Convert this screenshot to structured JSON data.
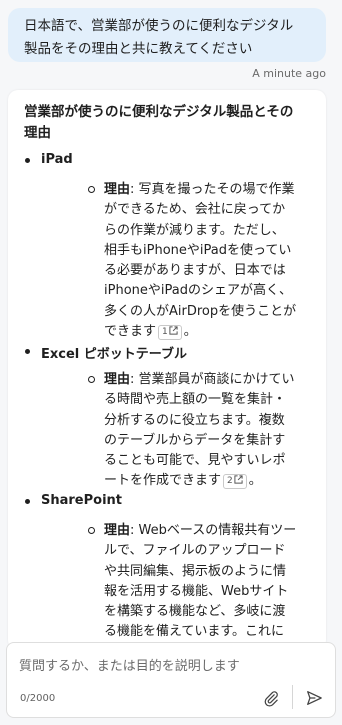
{
  "user_message": {
    "line1": "日本語で、営業部が使うのに便利なデジタル",
    "line2": "製品をその理由と共に教えてください",
    "timestamp": "A minute ago"
  },
  "answer": {
    "title_line1": "営業部が使うのに便利なデジタル製品とその",
    "title_line2": "理由",
    "reason_label": "理由",
    "items": [
      {
        "name": "iPad",
        "reason_lines": [
          ": 写真を撮ったその場で作業",
          "ができるため、会社に戻ってか",
          "らの作業が減ります。ただし、",
          "相手もiPhoneやiPadを使ってい",
          "る必要がありますが、日本では",
          "iPhoneやiPadのシェアが高く、",
          "多くの人がAirDropを使うことが",
          "できます"
        ],
        "citation": "1",
        "end": "。"
      },
      {
        "name": "Excel ピボットテーブル",
        "reason_lines": [
          ": 営業部員が商談にかけてい",
          "る時間や売上額の一覧を集計・",
          "分析するのに役立ちます。複数",
          "のテーブルからデータを集計す",
          "ることも可能で、見やすいレポ",
          "ートを作成できます"
        ],
        "citation": "2",
        "end": "。"
      },
      {
        "name": "SharePoint",
        "reason_lines": [
          ": Webベースの情報共有ツー",
          "ルで、ファイルのアップロード",
          "や共同編集、掲示板のように情",
          "報を活用する機能、Webサイト",
          "を構築する機能など、多岐に渡",
          "る機能を備えています。これに"
        ]
      }
    ]
  },
  "composer": {
    "placeholder": "質問するか、または目的を説明します",
    "counter": "0/2000"
  },
  "icons": {
    "external_link": "external-link-icon",
    "attach": "paperclip-icon",
    "send": "send-icon"
  }
}
